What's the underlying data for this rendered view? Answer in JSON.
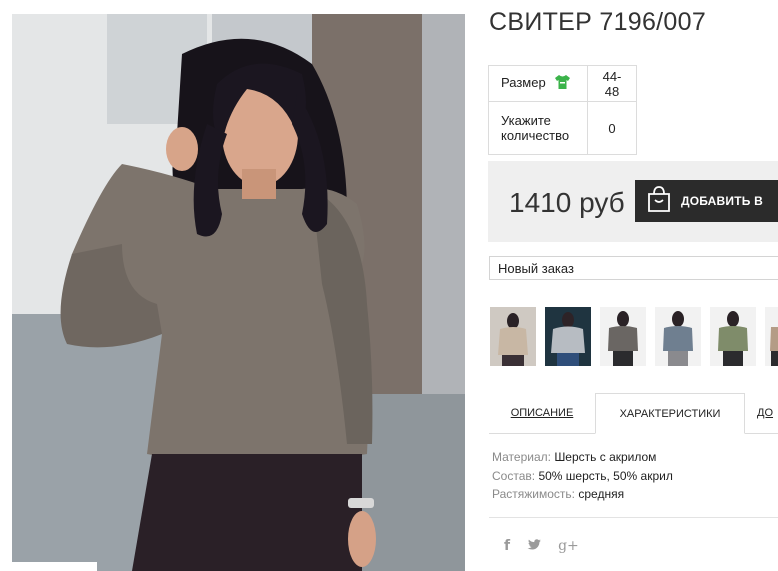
{
  "product": {
    "title": "СВИТЕР 7196/007",
    "size_label": "Размер",
    "size_value": "44-48",
    "qty_label": "Укажите количество",
    "qty_value": "0",
    "price": "1410 руб",
    "add_button": "ДОБАВИТЬ В"
  },
  "order_select": {
    "value": "Новый заказ"
  },
  "thumbnails": [
    "beige",
    "light-grey",
    "dark-grey",
    "blue-grey",
    "khaki",
    "partial"
  ],
  "tabs": {
    "description": "ОПИСАНИЕ",
    "characteristics": "ХАРАКТЕРИСТИКИ",
    "more": "ДО"
  },
  "specs": [
    {
      "key": "Материал:",
      "value": "Шерсть с акрилом"
    },
    {
      "key": "Состав:",
      "value": "50% шерсть, 50% акрил"
    },
    {
      "key": "Растяжимость:",
      "value": "средняя"
    }
  ],
  "social": {
    "facebook": "f",
    "twitter": "t",
    "googleplus": "g+"
  },
  "colors": {
    "button_bg": "#2b2b2b",
    "price_bg": "#efefef",
    "size_icon": "#3bb34a",
    "sweater": "#7d746c"
  }
}
